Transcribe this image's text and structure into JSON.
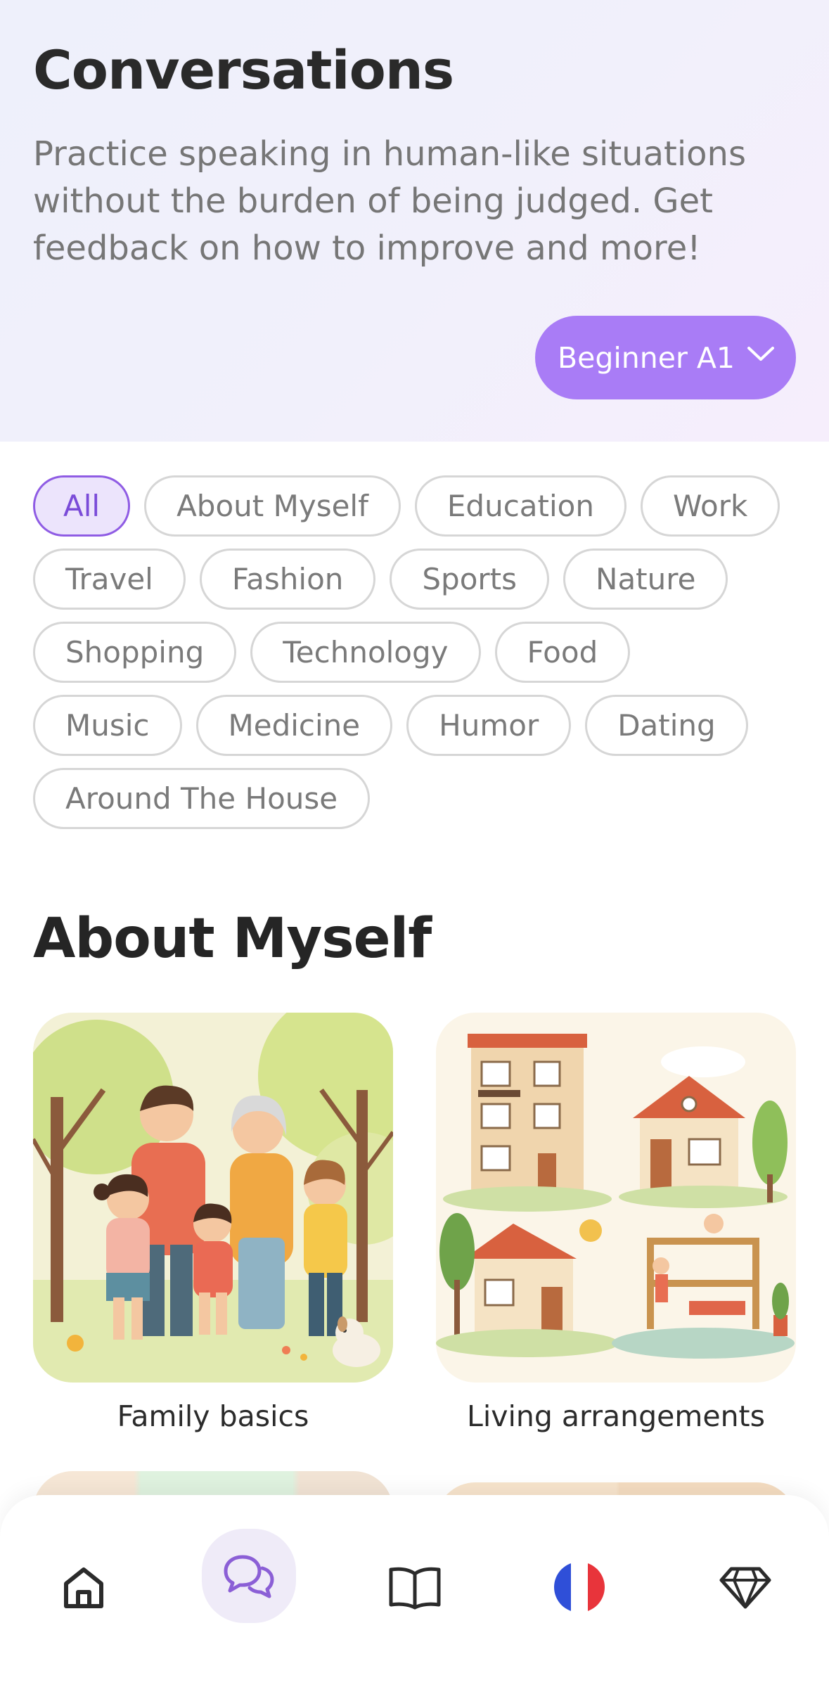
{
  "header": {
    "title": "Conversations",
    "subtitle": "Practice speaking in human-like situations without the burden of being judged. Get feedback on how to improve and more!",
    "level_label": "Beginner A1"
  },
  "categories": {
    "selected": "All",
    "rows": [
      [
        "All",
        "About Myself",
        "Education",
        "Work"
      ],
      [
        "Travel",
        "Fashion",
        "Sports",
        "Nature"
      ],
      [
        "Shopping",
        "Technology",
        "Food"
      ],
      [
        "Music",
        "Medicine",
        "Humor",
        "Dating"
      ],
      [
        "Around The House"
      ]
    ]
  },
  "section": {
    "title": "About Myself",
    "cards": [
      {
        "label": "Family basics",
        "image": "family-illustration"
      },
      {
        "label": "Living arrangements",
        "image": "houses-illustration"
      }
    ]
  },
  "nav": {
    "active": "conversations",
    "items": [
      "home-icon",
      "chat-bubbles-icon",
      "book-icon",
      "french-flag-icon",
      "diamond-icon"
    ]
  },
  "colors": {
    "accent": "#a97cf6",
    "chip_active_bg": "#ece4fc",
    "chip_active_border": "#8f5ce4",
    "chip_border": "#d6d6d6",
    "nav_active_bg": "#efebf8"
  }
}
